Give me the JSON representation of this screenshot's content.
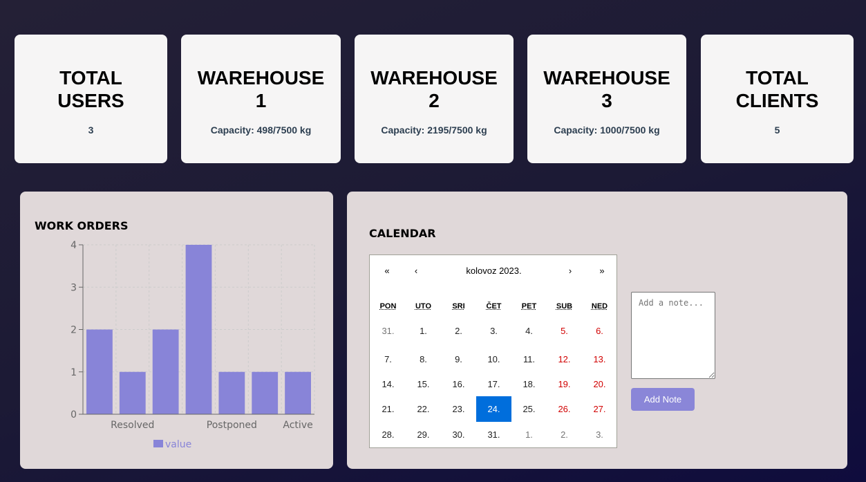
{
  "stats": [
    {
      "title": "TOTAL\nUSERS",
      "value": "3"
    },
    {
      "title": "WAREHOUSE\n1",
      "value": "Capacity: 498/7500 kg"
    },
    {
      "title": "WAREHOUSE\n2",
      "value": "Capacity: 2195/7500 kg"
    },
    {
      "title": "WAREHOUSE\n3",
      "value": "Capacity: 1000/7500 kg"
    },
    {
      "title": "TOTAL\nCLIENTS",
      "value": "5"
    }
  ],
  "work_orders": {
    "title": "WORK ORDERS",
    "colors": {
      "bar": "#8884d8",
      "grid": "#cccccc",
      "axis": "#666666"
    }
  },
  "chart_data": {
    "type": "bar",
    "categories": [
      "",
      "Resolved",
      "",
      "",
      "Postponed",
      "",
      "Active"
    ],
    "series": [
      {
        "name": "value",
        "values": [
          2,
          1,
          2,
          4,
          1,
          1,
          1
        ]
      }
    ],
    "ylim": [
      0,
      4
    ],
    "yticks": [
      0,
      1,
      2,
      3,
      4
    ],
    "grid": true,
    "legend": "bottom-center"
  },
  "calendar": {
    "title": "CALENDAR",
    "nav": {
      "prev2": "«",
      "prev": "‹",
      "label": "kolovoz 2023.",
      "next": "›",
      "next2": "»"
    },
    "weekdays": [
      "PON",
      "UTO",
      "SRI",
      "ČET",
      "PET",
      "SUB",
      "NED"
    ],
    "days": [
      [
        "31.",
        "1.",
        "2.",
        "3.",
        "4.",
        "5.",
        "6."
      ],
      [
        "7.",
        "8.",
        "9.",
        "10.",
        "11.",
        "12.",
        "13."
      ],
      [
        "14.",
        "15.",
        "16.",
        "17.",
        "18.",
        "19.",
        "20."
      ],
      [
        "21.",
        "22.",
        "23.",
        "24.",
        "25.",
        "26.",
        "27."
      ],
      [
        "28.",
        "29.",
        "30.",
        "31.",
        "1.",
        "2.",
        "3."
      ]
    ],
    "selected": "24.",
    "note_placeholder": "Add a note...",
    "add_button": "Add Note",
    "colors": {
      "selected": "#006edc",
      "weekend": "#d10000",
      "button": "#8a86d8"
    }
  }
}
